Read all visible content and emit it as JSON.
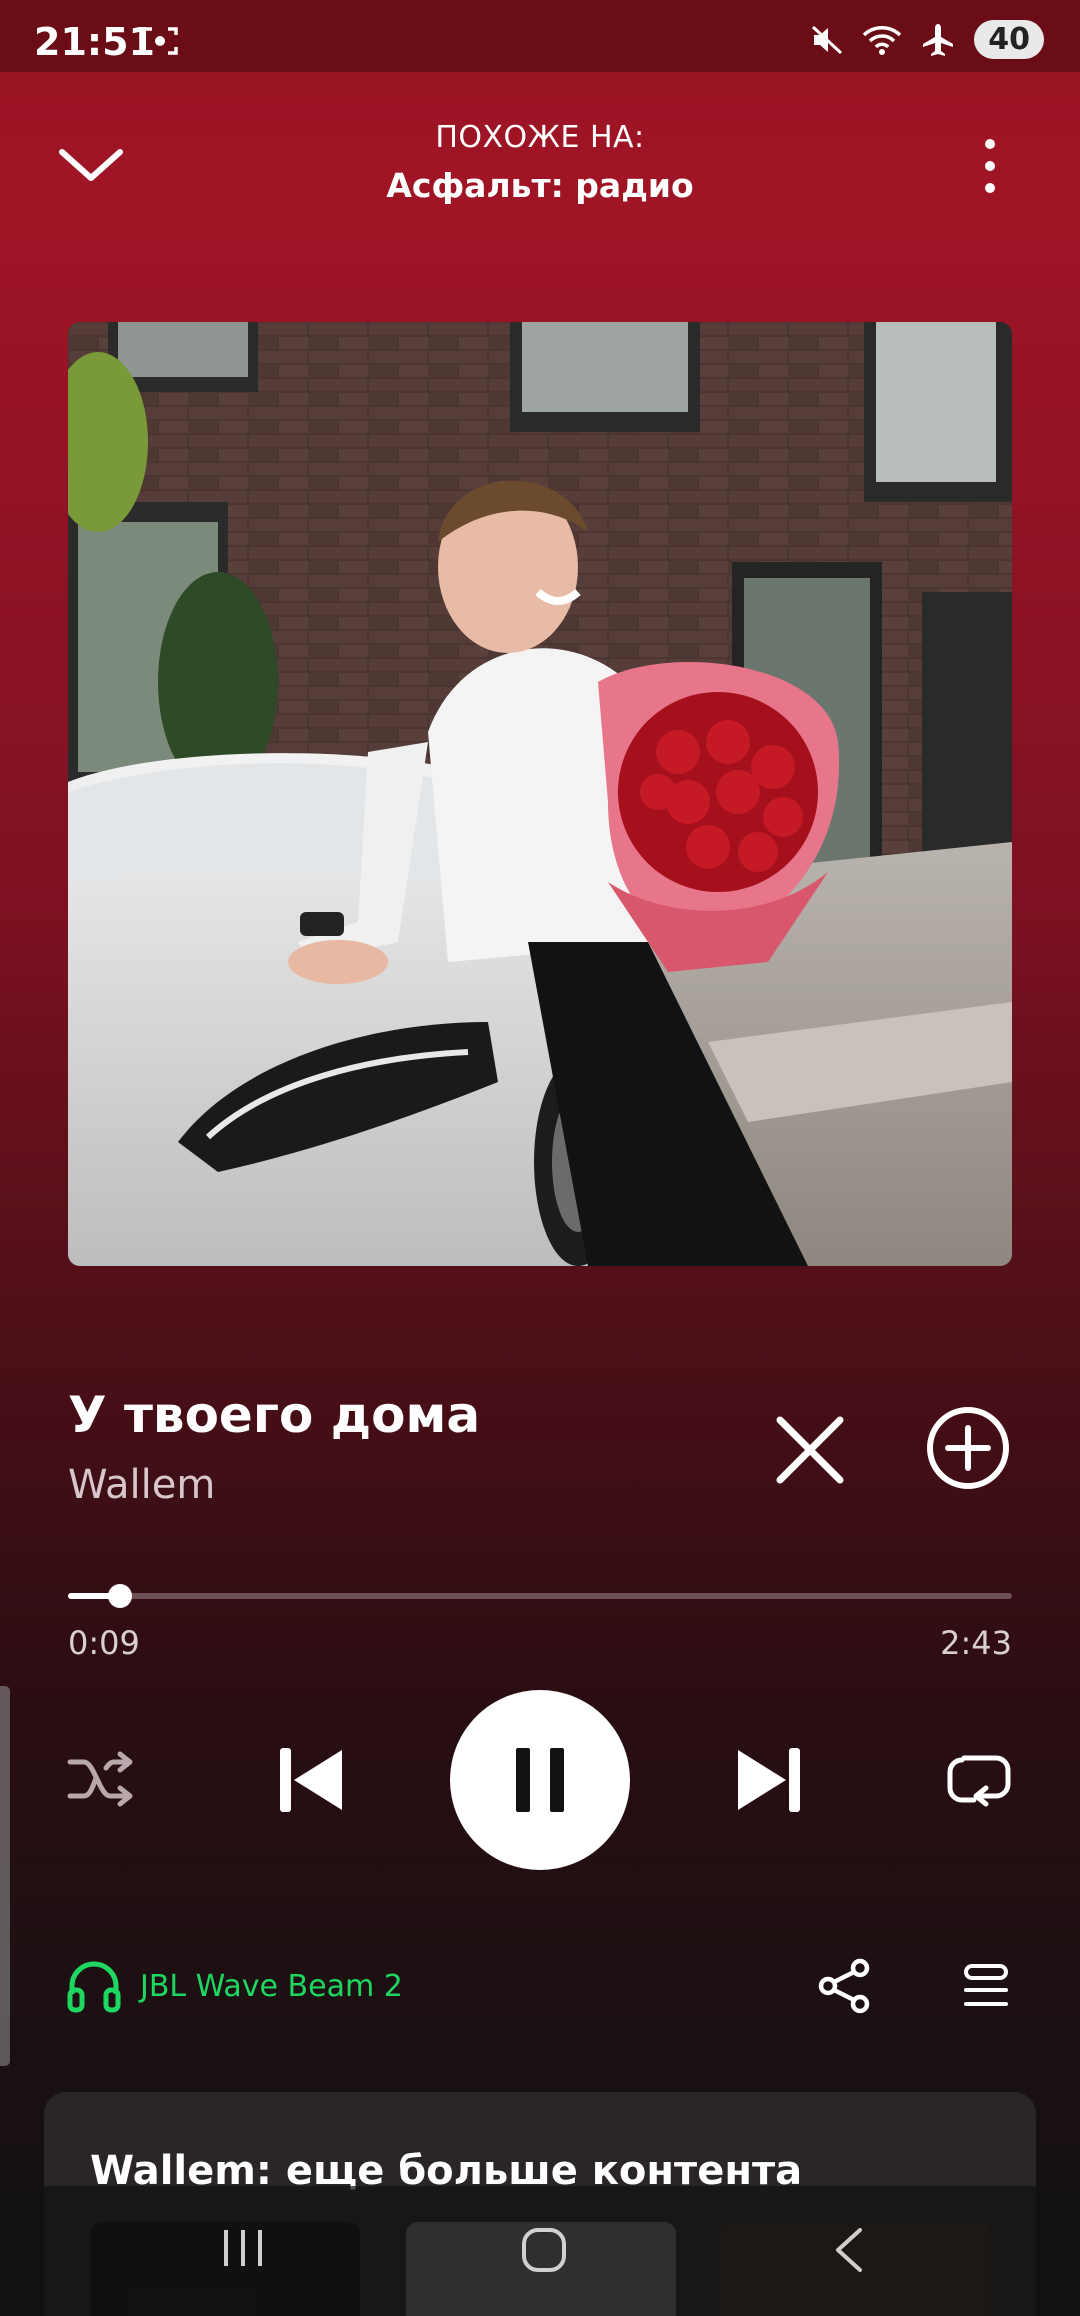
{
  "status_bar": {
    "time": "21:51",
    "battery": "40"
  },
  "header": {
    "context_label": "ПОХОЖЕ НА:",
    "context_title": "Асфальт: радио"
  },
  "track": {
    "title": "У твоего дома",
    "artist": "Wallem"
  },
  "progress": {
    "current": "0:09",
    "total": "2:43",
    "fraction": 0.055
  },
  "device": {
    "name": "JBL Wave Beam 2",
    "color": "#1ed760"
  },
  "recommend": {
    "title": "Wallem: еще больше контента"
  },
  "colors": {
    "accent_green": "#1ed760",
    "background_top": "#9a1424",
    "background_bottom": "#121010"
  }
}
